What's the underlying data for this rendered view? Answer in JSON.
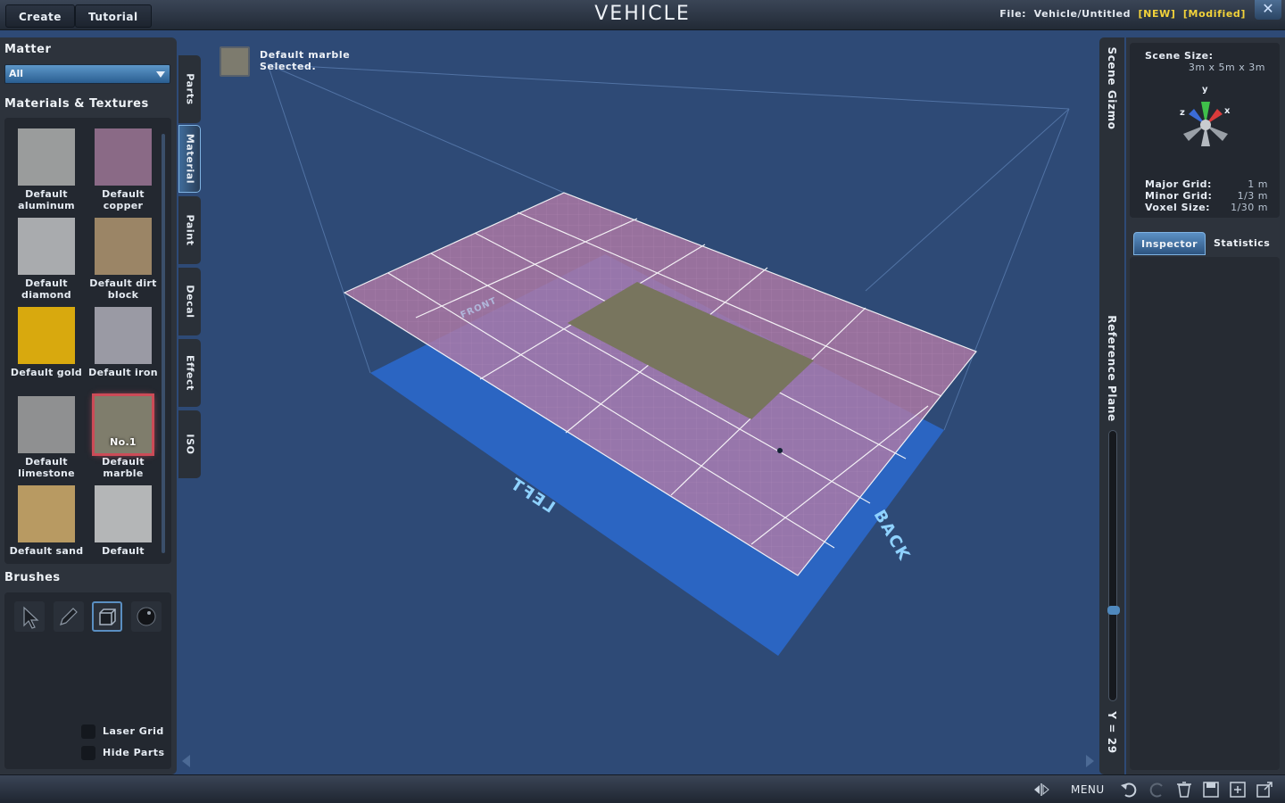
{
  "header": {
    "create_label": "Create",
    "tutorial_label": "Tutorial",
    "title": "VEHICLE",
    "file_label": "File:",
    "file_name": "Vehicle/Untitled",
    "tag_new": "[NEW]",
    "tag_modified": "[Modified]"
  },
  "left": {
    "matter_title": "Matter",
    "matter_value": "All",
    "materials_title": "Materials & Textures",
    "materials": [
      {
        "name": "Default aluminum",
        "color": "#9a9c9c"
      },
      {
        "name": "Default copper",
        "color": "#8a6a86"
      },
      {
        "name": "Default diamond",
        "color": "#a9abae"
      },
      {
        "name": "Default dirt block",
        "color": "#9b8566"
      },
      {
        "name": "Default gold",
        "color": "#d8a90e"
      },
      {
        "name": "Default iron",
        "color": "#9a9aa4"
      },
      {
        "name": "Default limestone",
        "color": "#8f9091"
      },
      {
        "name": "Default marble",
        "color": "#7f7d6c",
        "badge": "No.1"
      },
      {
        "name": "Default sand",
        "color": "#b89a62"
      },
      {
        "name": "Default",
        "color": "#b4b6b7"
      }
    ],
    "brushes_title": "Brushes",
    "laser_grid_label": "Laser Grid",
    "hide_parts_label": "Hide Parts"
  },
  "tabs": [
    "Parts",
    "Material",
    "Paint",
    "Decal",
    "Effect",
    "ISO"
  ],
  "selection": {
    "line1": "Default marble",
    "line2": "Selected."
  },
  "scene": {
    "front_label": "FRONT",
    "left_label": "LEFT",
    "back_label": "BACK"
  },
  "right": {
    "gizmo_tab": "Scene Gizmo",
    "reference_plane": "Reference Plane",
    "y_value": "Y = 29",
    "scene_size_label": "Scene Size:",
    "scene_size_value": "3m x 5m x 3m",
    "axis_y": "y",
    "axis_x": "x",
    "axis_z": "z",
    "major_grid_label": "Major Grid:",
    "major_grid_value": "1 m",
    "minor_grid_label": "Minor Grid:",
    "minor_grid_value": "1/3 m",
    "voxel_size_label": "Voxel Size:",
    "voxel_size_value": "1/30 m",
    "inspector_tab": "Inspector",
    "statistics_tab": "Statistics"
  },
  "footer": {
    "menu_label": "MENU"
  },
  "colors": {
    "viewport_bg": "#2e4a76",
    "grid_plane": "#b07aa6",
    "floor_plane": "#2a6ad0",
    "accent": "#5a8fc2",
    "selected_outline": "#cc4b57",
    "tag_yellow": "#f2d23a"
  }
}
